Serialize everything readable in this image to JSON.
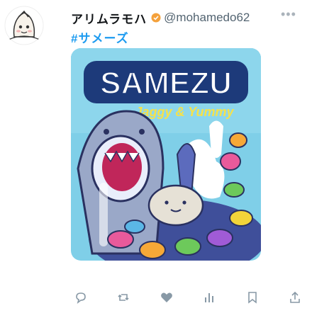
{
  "tweet": {
    "display_name": "アリムラモハ",
    "handle": "@mohamedo62",
    "hashtag": "#サメーズ",
    "more_label": "•••"
  },
  "media": {
    "logo_text": "SAMEZU",
    "tagline": "Jaggy & Yummy"
  },
  "icons": {
    "verified": "verified-badge-icon",
    "reply": "reply-icon",
    "retweet": "retweet-icon",
    "like": "heart-icon",
    "analytics": "analytics-icon",
    "bookmark": "bookmark-icon",
    "share": "share-icon"
  },
  "colors": {
    "link": "#1d9bf0",
    "verified": "#f4a13b",
    "icon_gray": "#8899a6"
  }
}
